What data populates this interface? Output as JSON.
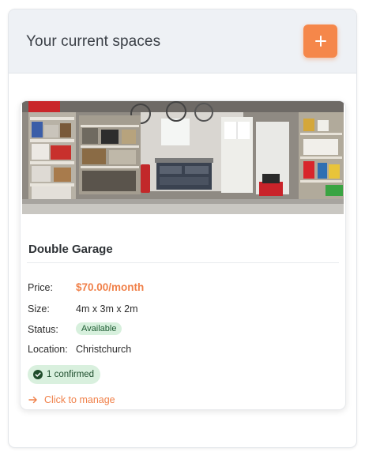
{
  "panel": {
    "title": "Your current spaces",
    "add_button_icon": "plus-icon"
  },
  "listing": {
    "image_alt": "garage-photo",
    "title": "Double Garage",
    "price_label": "Price:",
    "price_value": "$70.00/month",
    "size_label": "Size:",
    "size_value": "4m x 3m x 2m",
    "status_label": "Status:",
    "status_value": "Available",
    "location_label": "Location:",
    "location_value": "Christchurch",
    "confirmed_text": "1 confirmed",
    "confirmed_icon": "check-circle-icon",
    "manage_text": "Click to manage",
    "manage_icon": "arrow-right-icon"
  },
  "colors": {
    "accent": "#f5874a",
    "success_bg": "#d9f0de",
    "success_text": "#1d4d2c"
  }
}
